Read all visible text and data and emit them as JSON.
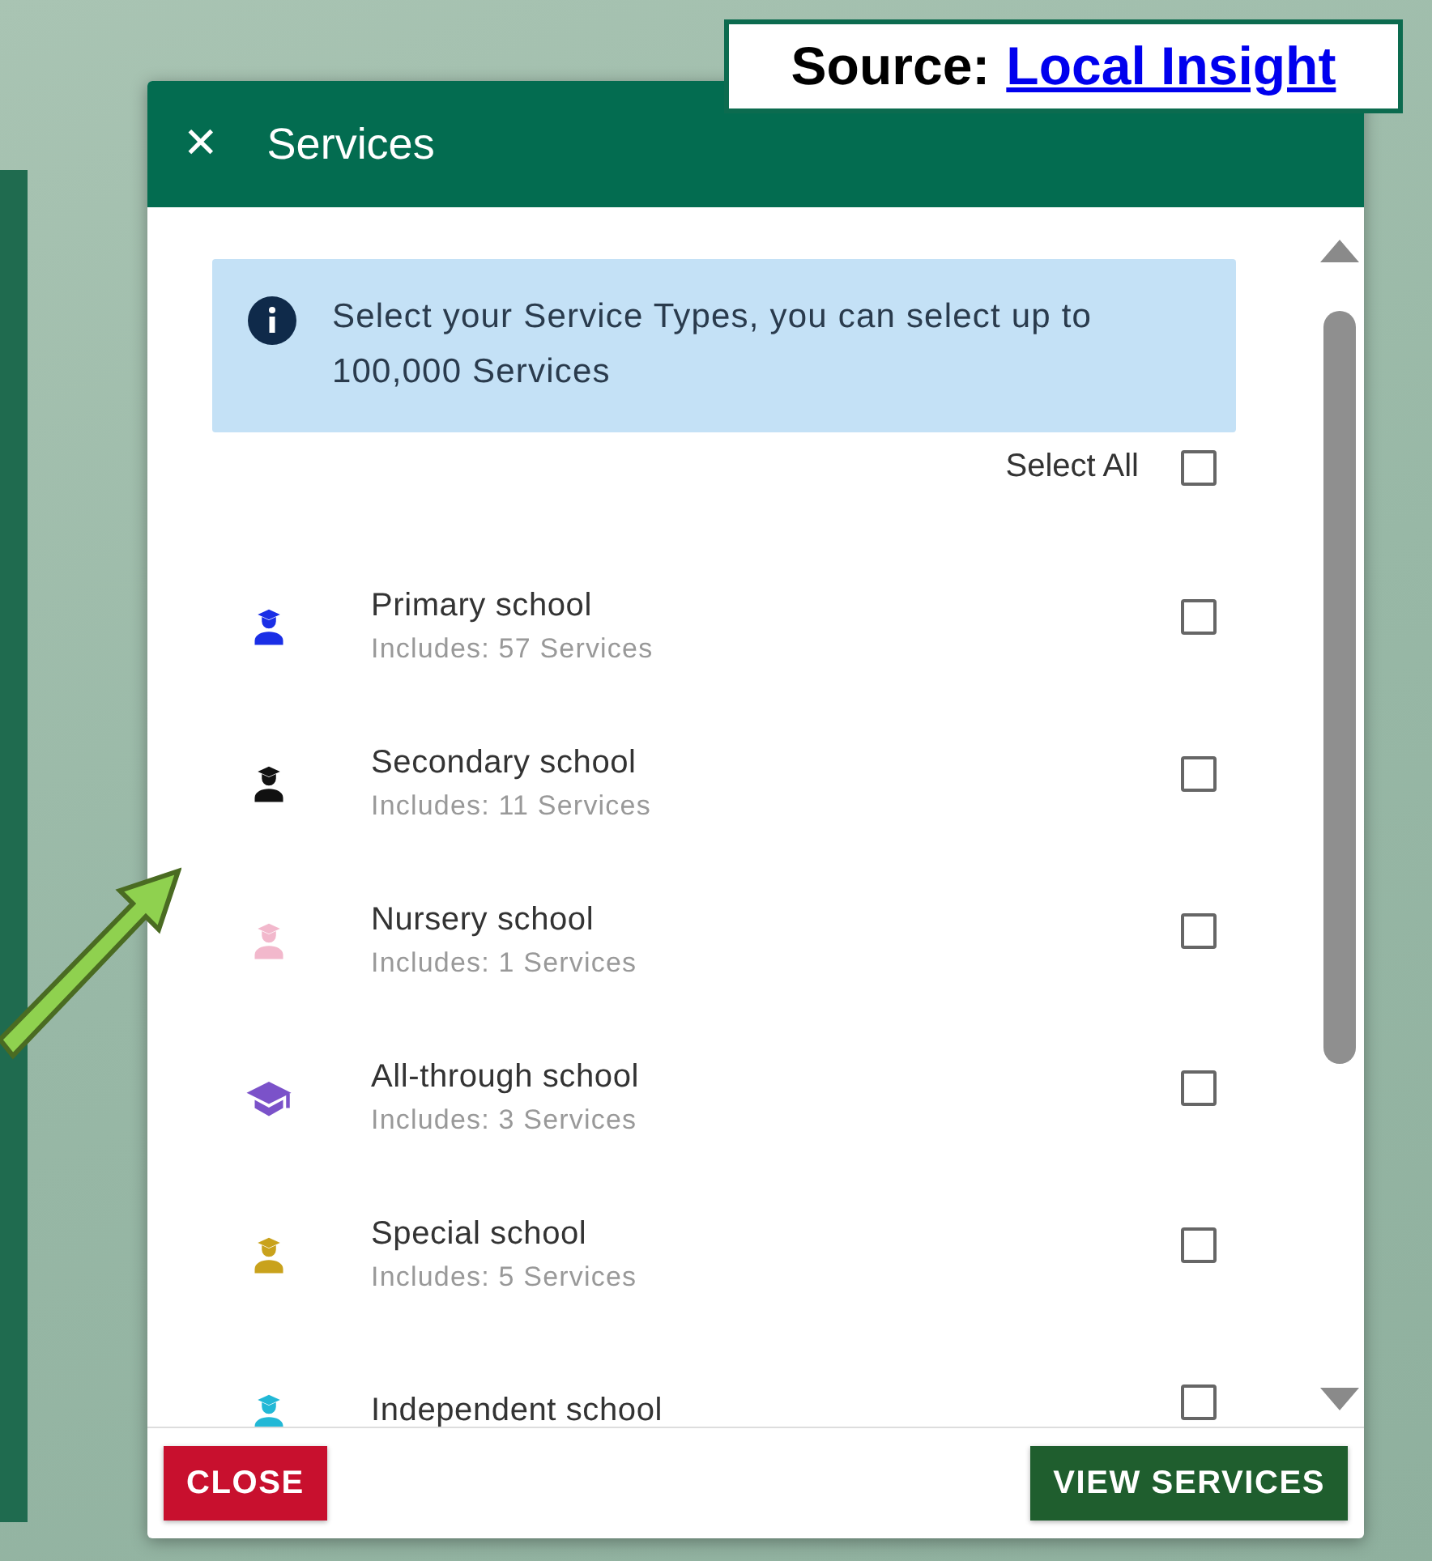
{
  "source_note": {
    "label": "Source:",
    "link": "Local Insight"
  },
  "dialog": {
    "title": "Services",
    "close_icon": "✕",
    "info": "Select your Service Types, you can select up to 100,000 Services",
    "select_all": {
      "label": "Select All",
      "checked": false
    },
    "services": [
      {
        "name": "Primary school",
        "count": "Includes: 57 Services",
        "kind": "person",
        "color": "#1a2ee6",
        "checked": false
      },
      {
        "name": "Secondary school",
        "count": "Includes: 11 Services",
        "kind": "person",
        "color": "#111111",
        "checked": false
      },
      {
        "name": "Nursery school",
        "count": "Includes: 1 Services",
        "kind": "person",
        "color": "#f2b8cc",
        "checked": false
      },
      {
        "name": "All-through school",
        "count": "Includes: 3 Services",
        "kind": "cap",
        "color": "#7b52c9",
        "checked": false
      },
      {
        "name": "Special school",
        "count": "Includes: 5 Services",
        "kind": "person",
        "color": "#c9a21c",
        "checked": false
      },
      {
        "name": "Independent school",
        "kind": "person",
        "color": "#22b8d6",
        "checked": false
      }
    ],
    "buttons": {
      "close": "CLOSE",
      "view": "VIEW SERVICES"
    }
  }
}
